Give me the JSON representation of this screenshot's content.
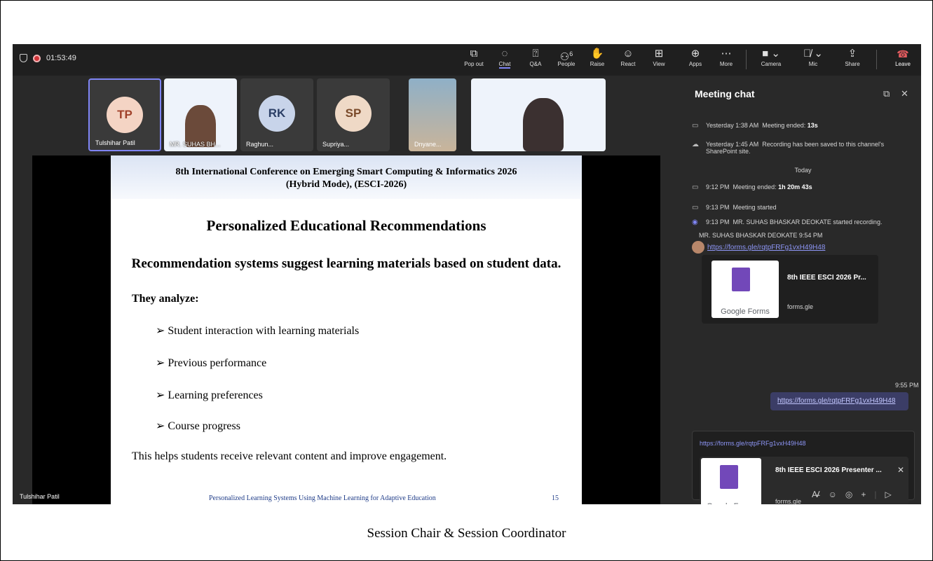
{
  "timer": "01:53:49",
  "toolbar": {
    "popout": "Pop out",
    "chat": "Chat",
    "qa": "Q&A",
    "people": "People",
    "people_count": "6",
    "raise": "Raise",
    "react": "React",
    "view": "View",
    "apps": "Apps",
    "more": "More",
    "camera": "Camera",
    "mic": "Mic",
    "share": "Share",
    "leave": "Leave"
  },
  "participants": [
    {
      "initials": "TP",
      "name": "Tulshihar Patil",
      "color": "#f4d4c4",
      "text": "#a0412a"
    },
    {
      "name": "MR. SUHAS BH..."
    },
    {
      "initials": "RK",
      "name": "Raghun...",
      "color": "#c8d4ea",
      "text": "#2b3f66"
    },
    {
      "initials": "SP",
      "name": "Supriya...",
      "color": "#efd9c6",
      "text": "#7a4a2a"
    },
    {
      "name": "Dnyane..."
    }
  ],
  "slide": {
    "title_line1": "8th International Conference on Emerging Smart Computing & Informatics 2026",
    "title_line2": "(Hybrid Mode), (ESCI-2026)",
    "heading": "Personalized Educational Recommendations",
    "subheading": "Recommendation systems suggest learning materials based on student data.",
    "analyze": "They analyze:",
    "bullets": [
      "➢ Student interaction with learning materials",
      "➢ Previous performance",
      "➢ Learning preferences",
      "➢ Course progress"
    ],
    "conclusion": "This helps students receive relevant content and improve engagement.",
    "footer": "Personalized Learning Systems Using Machine Learning for Adaptive Education",
    "page": "15"
  },
  "presenter_name": "Tulshihar Patil",
  "chat": {
    "title": "Meeting chat",
    "events": [
      {
        "time": "Yesterday 1:38 AM",
        "text": "Meeting ended:",
        "bold": "13s"
      },
      {
        "time": "Yesterday 1:45 AM",
        "text": "Recording has been saved to this channel's",
        "text2": "SharePoint site."
      },
      {
        "time": "9:12 PM",
        "text": "Meeting ended:",
        "bold": "1h 20m 43s"
      },
      {
        "time": "9:13 PM",
        "text": "Meeting started"
      },
      {
        "time": "9:13 PM",
        "text": "MR. SUHAS BHASKAR DEOKATE started recording."
      }
    ],
    "today": "Today",
    "sender": "MR. SUHAS BHASKAR DEOKATE  9:54 PM",
    "link": "https://forms.gle/rqtpFRFg1vxH49H48",
    "card_title": "8th IEEE ESCI 2026 Pr...",
    "card_domain": "forms.gle",
    "google_forms": "Google Forms",
    "sent_time": "9:55 PM",
    "sent_link": "https://forms.gle/rqtpFRFg1vxH49H48",
    "compose_link": "https://forms.gle/rqtpFRFg1vxH49H48",
    "compose_card_title": "8th IEEE ESCI 2026 Presenter ...",
    "compose_card_domain": "forms.gle"
  },
  "caption": "Session Chair & Session Coordinator"
}
